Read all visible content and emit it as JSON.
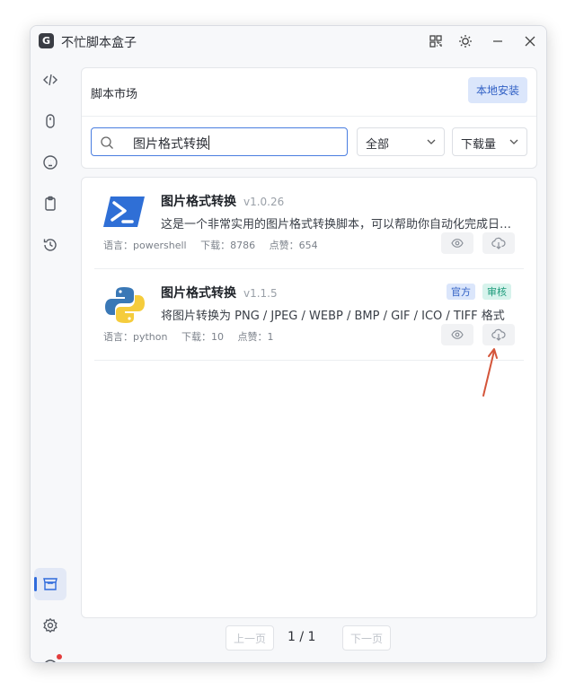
{
  "window": {
    "title": "不忙脚本盒子",
    "logo_text": "G"
  },
  "titlebar_icons": [
    "grid-icon",
    "sun-icon",
    "minimize-icon",
    "close-icon"
  ],
  "sidebar": {
    "items": [
      {
        "name": "code-icon",
        "active": false
      },
      {
        "name": "mouse-icon",
        "active": false
      },
      {
        "name": "keyboard-icon",
        "active": false
      },
      {
        "name": "clipboard-icon",
        "active": false
      },
      {
        "name": "history-icon",
        "active": false
      },
      {
        "name": "store-icon",
        "active": true
      },
      {
        "name": "gear-icon",
        "active": false
      },
      {
        "name": "user-icon",
        "active": false,
        "notification": true
      }
    ]
  },
  "market": {
    "title": "脚本市场",
    "local_install_label": "本地安装"
  },
  "search": {
    "value": "图片格式转换",
    "placeholder": ""
  },
  "filters": {
    "category": "全部",
    "sort": "下载量"
  },
  "scripts": [
    {
      "name": "图片格式转换",
      "version": "v1.0.26",
      "description": "这是一个非常实用的图片格式转换脚本，可以帮助你自动化完成日常图片格式转换任务",
      "language_label": "语言：powershell",
      "downloads_label": "下载：8786",
      "likes_label": "点赞：654",
      "icon": "powershell-icon",
      "badges": []
    },
    {
      "name": "图片格式转换",
      "version": "v1.1.5",
      "description": "将图片转换为 PNG / JPEG / WEBP / BMP / GIF / ICO / TIFF 格式",
      "language_label": "语言：python",
      "downloads_label": "下载：10",
      "likes_label": "点赞：1",
      "icon": "python-icon",
      "badges": [
        "官方",
        "审核"
      ]
    }
  ],
  "pagination": {
    "prev_label": "上一页",
    "next_label": "下一页",
    "page_info": "1 / 1"
  },
  "colors": {
    "accent": "#2f6bdc",
    "annotation_arrow": "#d4553a"
  }
}
